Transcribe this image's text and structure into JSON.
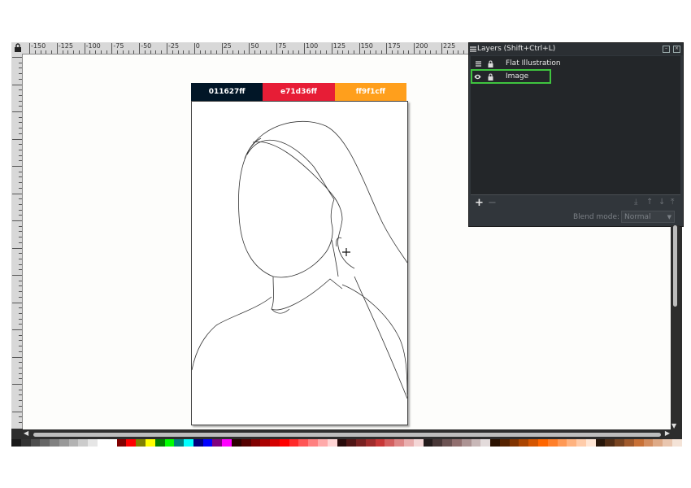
{
  "colors": {
    "panel_bg": "#31363b",
    "selection_green": "#3fc43f",
    "swatch_1": "#011627",
    "swatch_2": "#e71d36",
    "swatch_3": "#ff9f1c"
  },
  "ruler": {
    "top_labels": [
      "-150",
      "-125",
      "-100",
      "-75",
      "-50",
      "-25",
      "0",
      "25",
      "50",
      "75",
      "100",
      "125",
      "150",
      "175",
      "200",
      "225"
    ]
  },
  "canvas": {
    "swatches": [
      {
        "label": "011627ff",
        "color": "#011627"
      },
      {
        "label": "e71d36ff",
        "color": "#e71d36"
      },
      {
        "label": "ff9f1cff",
        "color": "#ff9f1c"
      }
    ]
  },
  "layers_panel": {
    "title": "Layers (Shift+Ctrl+L)",
    "layers": [
      {
        "name": "Flat Illustration",
        "icon": "layer-stack-icon",
        "selected": false
      },
      {
        "name": "Image",
        "icon": "eye-icon",
        "selected": true
      }
    ],
    "blend_mode_label": "Blend mode:",
    "blend_mode_value": "Normal"
  },
  "palette": [
    "#1a1a1a",
    "#333333",
    "#4d4d4d",
    "#666666",
    "#808080",
    "#999999",
    "#b3b3b3",
    "#cccccc",
    "#e6e6e6",
    "#ffffff",
    "#ffffff",
    "#800000",
    "#ff0000",
    "#808000",
    "#ffff00",
    "#008000",
    "#00ff00",
    "#008080",
    "#00ffff",
    "#000080",
    "#0000ff",
    "#800080",
    "#ff00ff",
    "#2b0000",
    "#550000",
    "#800000",
    "#aa0000",
    "#d40000",
    "#ff0000",
    "#ff2a2a",
    "#ff5555",
    "#ff8080",
    "#ffaaaa",
    "#ffd5d5",
    "#280b0b",
    "#501616",
    "#782121",
    "#a02c2c",
    "#c83737",
    "#d35f5f",
    "#de8787",
    "#e9afaf",
    "#f4d7d7",
    "#241c1c",
    "#483737",
    "#6c5353",
    "#916f6f",
    "#ac9393",
    "#c8b7b7",
    "#e3dbdb",
    "#2b1100",
    "#552200",
    "#803300",
    "#aa4400",
    "#d45500",
    "#ff6600",
    "#ff7f2a",
    "#ff9955",
    "#ffb380",
    "#ffccaa",
    "#ffe6d5",
    "#28170b",
    "#502d16",
    "#784421",
    "#a05a2c",
    "#c87137",
    "#d38d5f",
    "#deaa87",
    "#e9c6af",
    "#f4e3d7"
  ]
}
